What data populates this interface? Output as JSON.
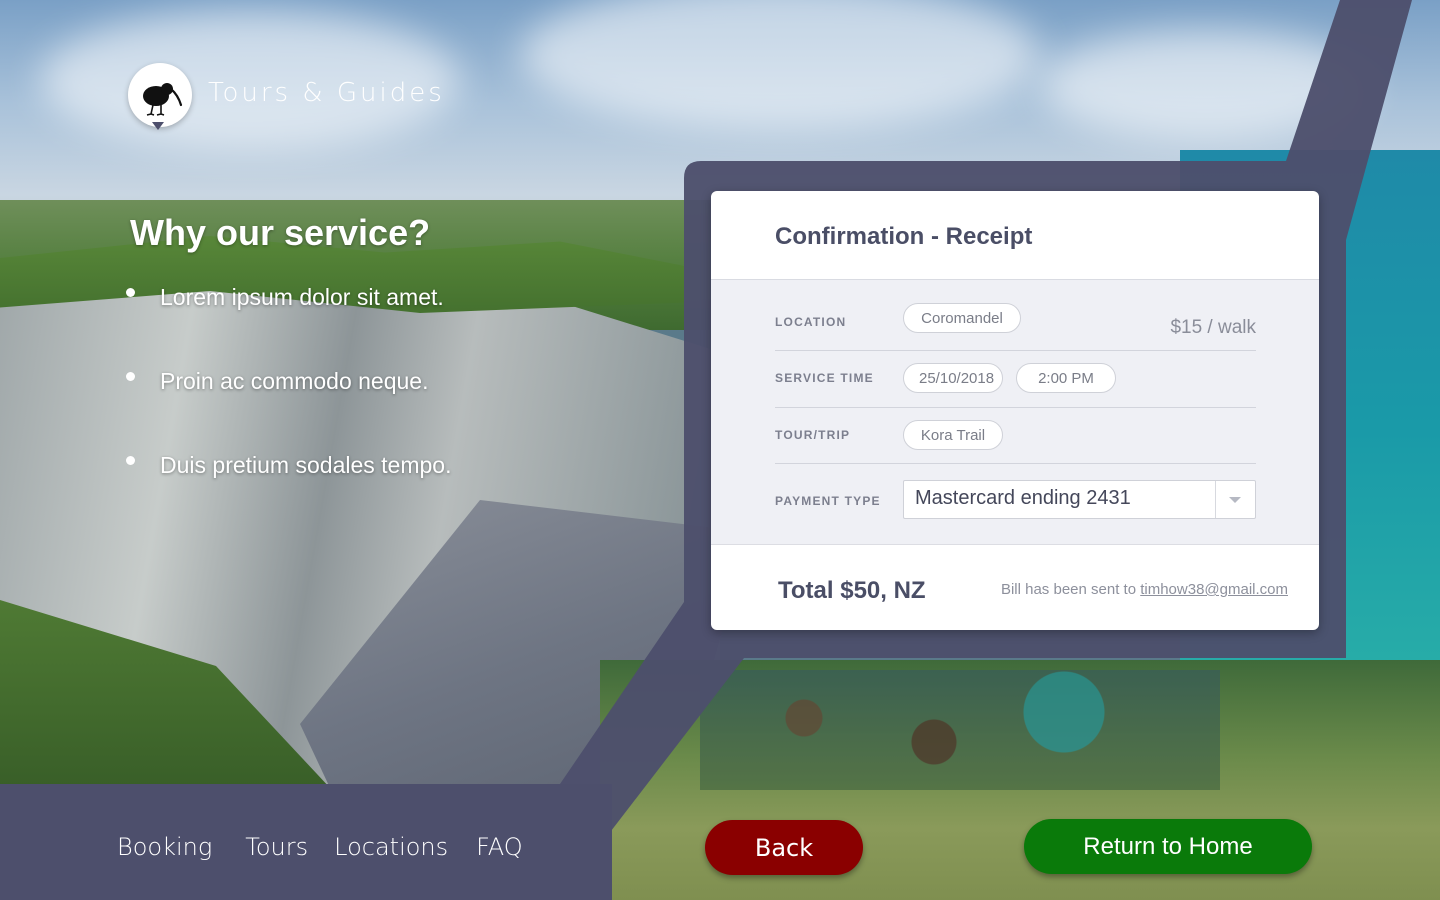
{
  "brand": {
    "name": "Tours & Guides",
    "logo_icon": "kiwi-bird-icon"
  },
  "intro": {
    "heading": "Why our service?",
    "points": [
      "Lorem ipsum dolor sit amet.",
      "Proin ac commodo neque.",
      "Duis pretium sodales tempo."
    ]
  },
  "receipt": {
    "title": "Confirmation - Receipt",
    "location": {
      "label": "LOCATION",
      "value": "Coromandel",
      "price": "$15 / walk"
    },
    "service_time": {
      "label": "SERVICE TIME",
      "date": "25/10/2018",
      "time": "2:00 PM"
    },
    "tour": {
      "label": "TOUR/TRIP",
      "value": "Kora Trail"
    },
    "payment": {
      "label": "PAYMENT TYPE",
      "selected": "Mastercard ending 2431"
    },
    "total": "Total $50, NZ",
    "bill_sent_text": "Bill has been sent to",
    "email": "timhow38@gmail.com"
  },
  "nav": {
    "booking": "Booking",
    "tours": "Tours",
    "locations": "Locations",
    "faq": "FAQ"
  },
  "buttons": {
    "back": "Back",
    "home": "Return to Home"
  },
  "colors": {
    "panel": "#4d4f6c",
    "back_button": "#8a0000",
    "home_button": "#0a7a0a",
    "heading_text": "#4a4e66"
  }
}
